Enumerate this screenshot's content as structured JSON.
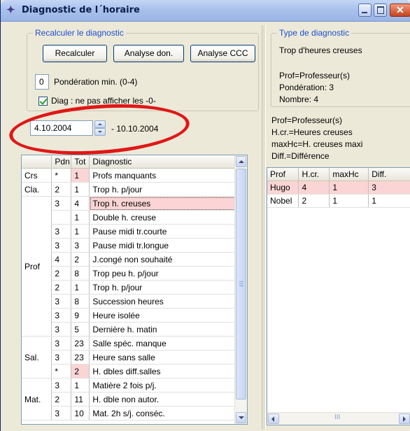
{
  "window": {
    "title": "Diagnostic de l´horaire",
    "icon": "wand-icon",
    "controls": {
      "minimize": "minimize-icon",
      "maximize": "maximize-icon",
      "close": "✕"
    }
  },
  "recalc": {
    "legend": "Recalculer le diagnostic",
    "buttons": {
      "recalculer": "Recalculer",
      "analyse_don": "Analyse don.",
      "analyse_ccc": "Analyse CCC"
    },
    "ponderation_value": "0",
    "ponderation_label": "Pondération min. (0-4)",
    "diag_checkbox_label": "Diag : ne pas afficher les -0-",
    "diag_checked": true
  },
  "date_range": {
    "start": "4.10.2004",
    "end_label": "- 10.10.2004"
  },
  "left_grid": {
    "headers": [
      "",
      "Pdn",
      "Tot",
      "Diagnostic"
    ],
    "groups": [
      {
        "category": "Crs",
        "rows": [
          {
            "pdn": "*",
            "tot": "1",
            "diag": "Profs manquants",
            "highlight_tot": true,
            "highlight_diag": false
          }
        ]
      },
      {
        "category": "Cla.",
        "rows": [
          {
            "pdn": "2",
            "tot": "1",
            "diag": "Trop h. p/jour",
            "highlight_tot": false,
            "highlight_diag": false
          }
        ]
      },
      {
        "category": "Prof",
        "rows": [
          {
            "pdn": "3",
            "tot": "4",
            "diag": "Trop h. creuses",
            "highlight_tot": false,
            "highlight_diag": true
          },
          {
            "pdn": "",
            "tot": "1",
            "diag": "Double h. creuse",
            "highlight_tot": false,
            "highlight_diag": false
          },
          {
            "pdn": "3",
            "tot": "1",
            "diag": "Pause midi tr.courte",
            "highlight_tot": false,
            "highlight_diag": false
          },
          {
            "pdn": "3",
            "tot": "3",
            "diag": "Pause midi tr.longue",
            "highlight_tot": false,
            "highlight_diag": false
          },
          {
            "pdn": "4",
            "tot": "2",
            "diag": "J.congé non souhaité",
            "highlight_tot": false,
            "highlight_diag": false
          },
          {
            "pdn": "2",
            "tot": "8",
            "diag": "Trop peu h. p/jour",
            "highlight_tot": false,
            "highlight_diag": false
          },
          {
            "pdn": "2",
            "tot": "1",
            "diag": "Trop h. p/jour",
            "highlight_tot": false,
            "highlight_diag": false
          },
          {
            "pdn": "3",
            "tot": "8",
            "diag": "Succession heures",
            "highlight_tot": false,
            "highlight_diag": false
          },
          {
            "pdn": "3",
            "tot": "9",
            "diag": "Heure isolée",
            "highlight_tot": false,
            "highlight_diag": false
          },
          {
            "pdn": "3",
            "tot": "5",
            "diag": "Dernière h. matin",
            "highlight_tot": false,
            "highlight_diag": false
          }
        ]
      },
      {
        "category": "Sal.",
        "rows": [
          {
            "pdn": "3",
            "tot": "23",
            "diag": "Salle spéc. manque",
            "highlight_tot": false,
            "highlight_diag": false
          },
          {
            "pdn": "3",
            "tot": "23",
            "diag": "Heure sans salle",
            "highlight_tot": false,
            "highlight_diag": false
          },
          {
            "pdn": "*",
            "tot": "2",
            "diag": "H. dbles diff.salles",
            "highlight_tot": true,
            "highlight_diag": false
          }
        ]
      },
      {
        "category": "Mat.",
        "rows": [
          {
            "pdn": "3",
            "tot": "1",
            "diag": "Matière 2 fois p/j.",
            "highlight_tot": false,
            "highlight_diag": false
          },
          {
            "pdn": "2",
            "tot": "11",
            "diag": "H. dble non autor.",
            "highlight_tot": false,
            "highlight_diag": false
          },
          {
            "pdn": "3",
            "tot": "10",
            "diag": "Mat. 2h s/j. conséc.",
            "highlight_tot": false,
            "highlight_diag": false
          }
        ]
      }
    ]
  },
  "type_diag": {
    "legend": "Type de diagnostic",
    "title": "Trop d'heures creuses",
    "details": [
      "Prof=Professeur(s)",
      "Pondération: 3",
      "Nombre: 4"
    ]
  },
  "legend_text": [
    "Prof=Professeur(s)",
    "H.cr.=Heures creuses",
    "maxHc=H. creuses maxi",
    "Diff.=Différence"
  ],
  "right_grid": {
    "headers": [
      "Prof",
      "H.cr.",
      "maxHc",
      "Diff."
    ],
    "rows": [
      {
        "cells": [
          "Hugo",
          "4",
          "1",
          "3"
        ],
        "highlight": true
      },
      {
        "cells": [
          "Nobel",
          "2",
          "1",
          "1"
        ],
        "highlight": false
      }
    ],
    "hscroll_grip": "III"
  },
  "colors": {
    "accent": "#1e4fd0",
    "highlight": "#fbd5d5",
    "annotation": "#e01717"
  }
}
